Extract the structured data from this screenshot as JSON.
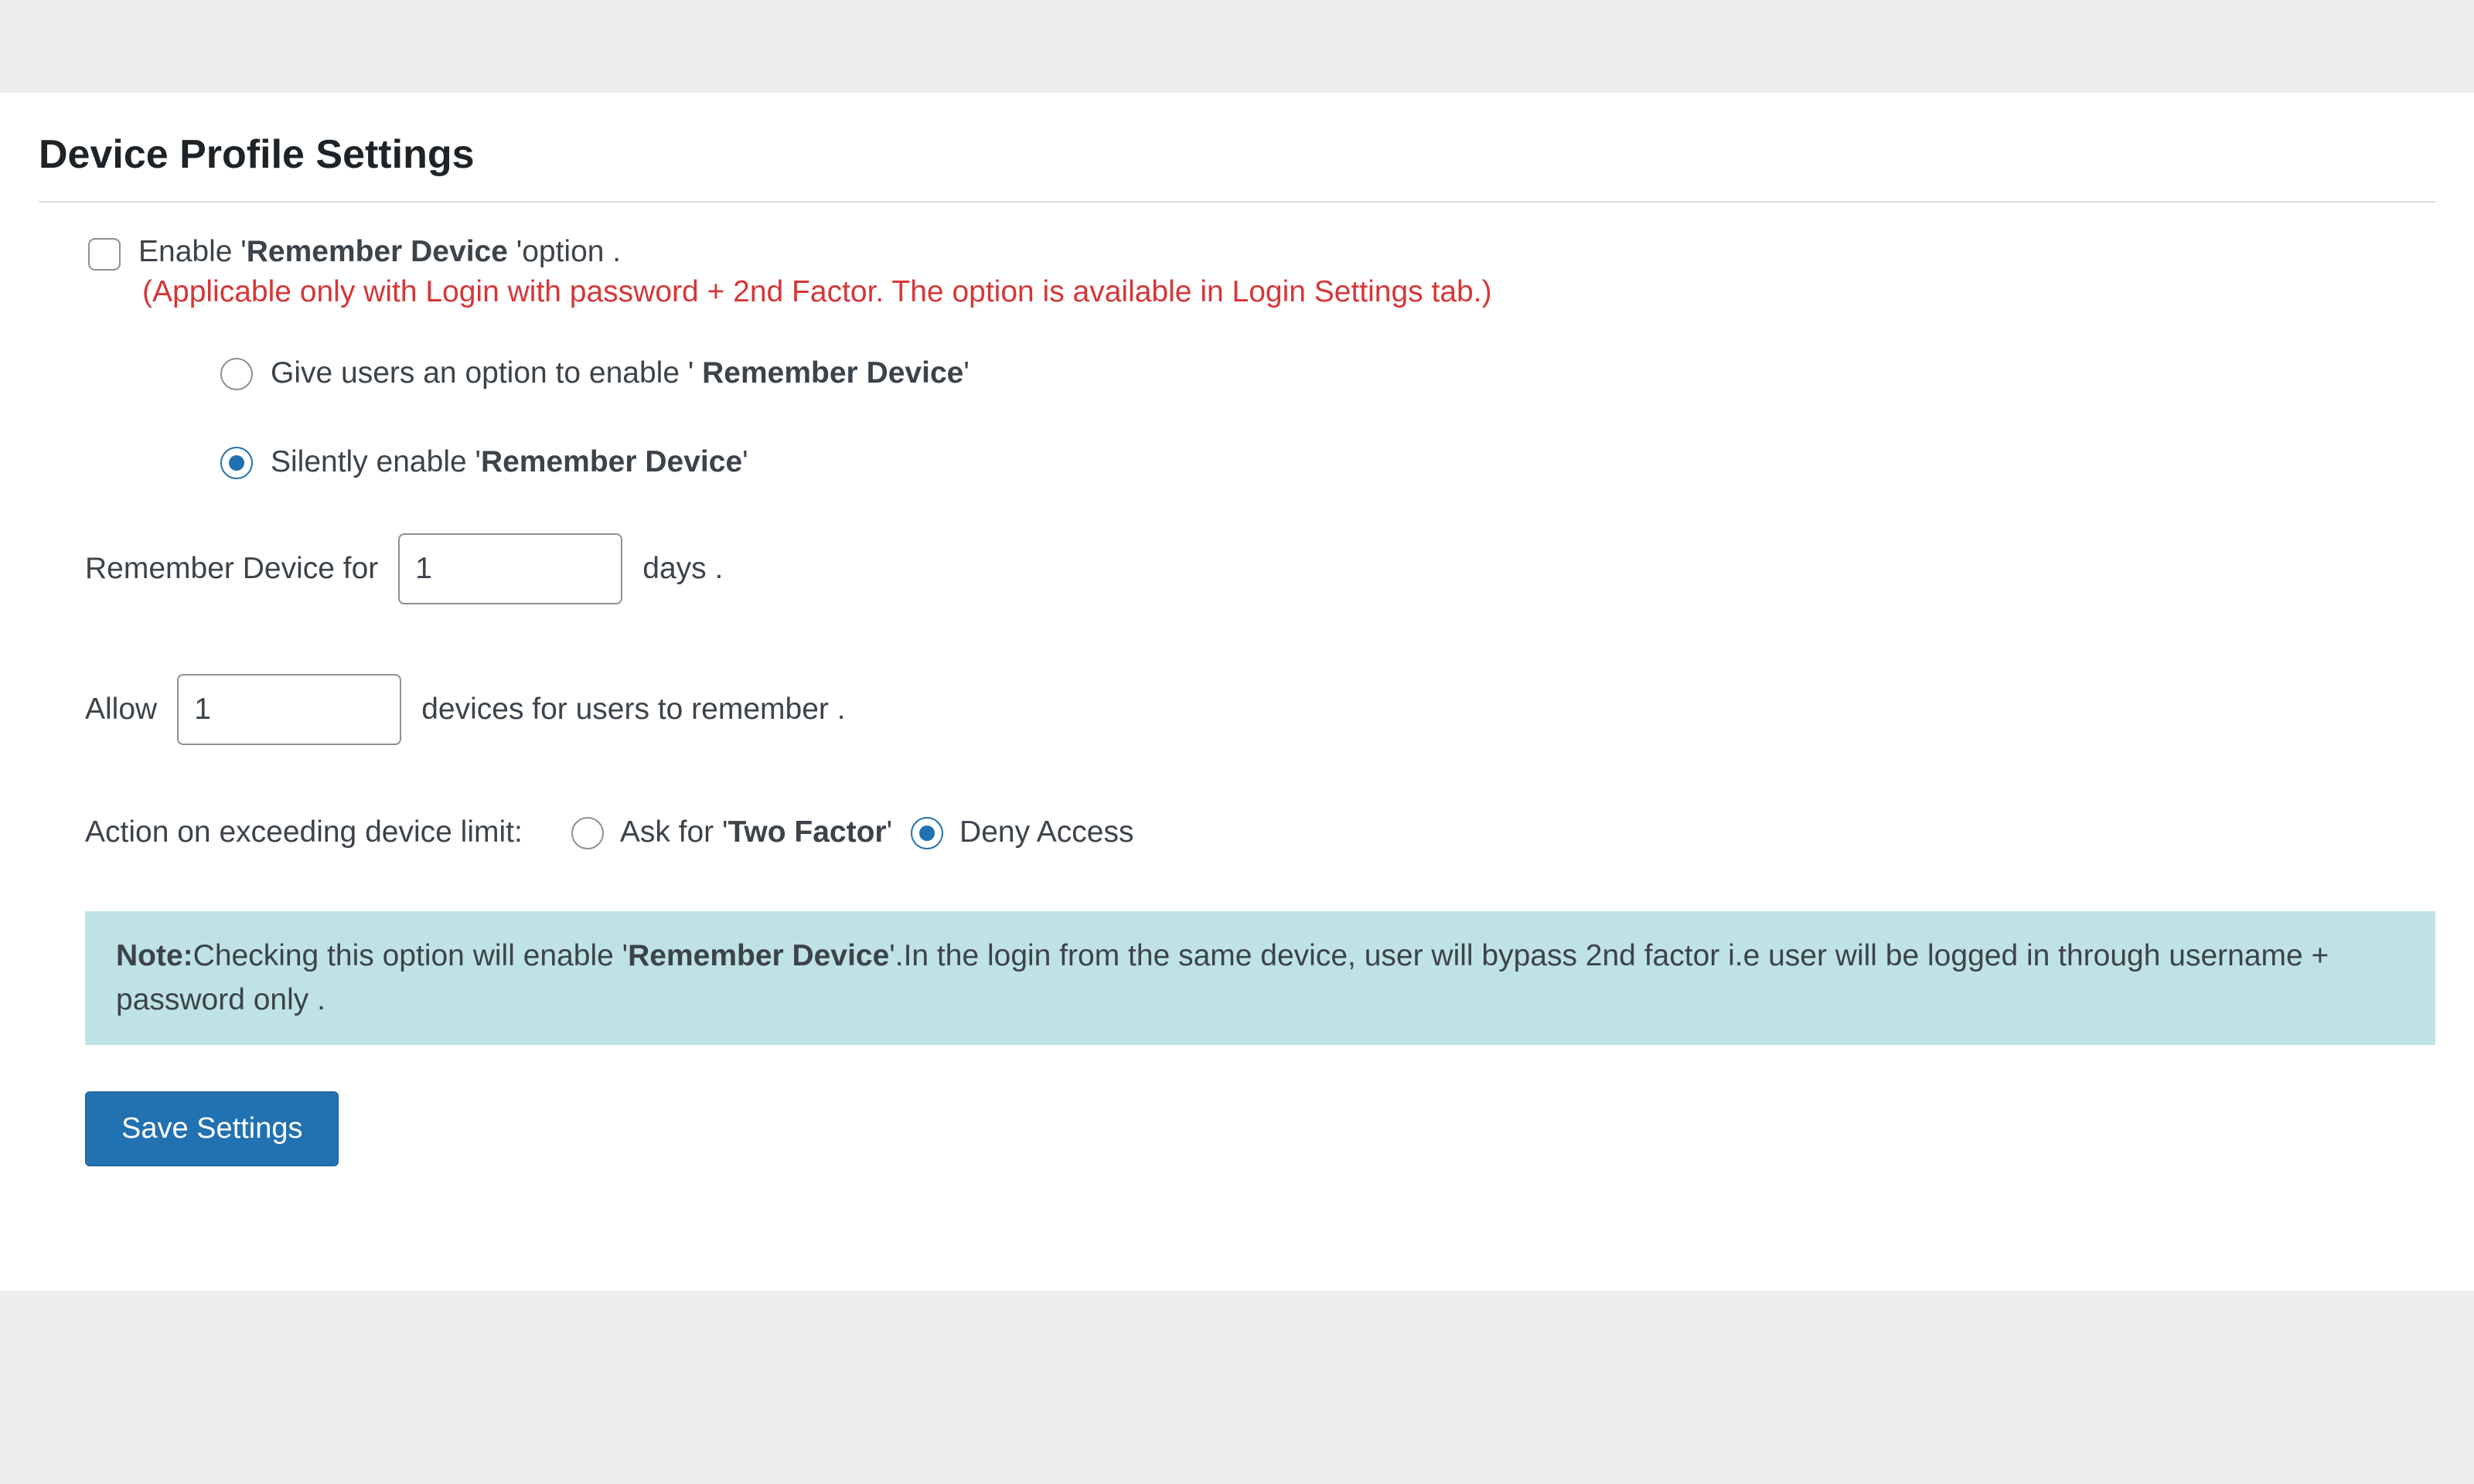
{
  "title": "Device Profile Settings",
  "enable": {
    "pre": "Enable '",
    "bold": "Remember Device",
    "post": " 'option .",
    "checked": false,
    "note": "(Applicable only with Login with password + 2nd Factor. The option is available in Login Settings tab.)"
  },
  "mode": {
    "option_user": {
      "pre": "Give users an option to enable ' ",
      "bold": "Remember Device",
      "post": "'",
      "selected": false
    },
    "option_silent": {
      "pre": "Silently enable '",
      "bold": "Remember Device",
      "post": "'",
      "selected": true
    }
  },
  "days": {
    "label": "Remember Device for",
    "value": "1",
    "suffix": "days ."
  },
  "devices": {
    "label": "Allow",
    "value": "1",
    "suffix": "devices for users to remember ."
  },
  "action": {
    "label": "Action on exceeding device limit:",
    "ask": {
      "pre": "Ask for '",
      "bold": "Two Factor",
      "post": "'",
      "selected": false
    },
    "deny": {
      "label": "Deny Access",
      "selected": true
    }
  },
  "note": {
    "bold1": "Note:",
    "t1": "Checking this option will enable '",
    "bold2": "Remember Device",
    "t2": "'.In the login from the same device, user will bypass 2nd factor i.e user will be logged in through username + password only ."
  },
  "save_label": "Save Settings"
}
